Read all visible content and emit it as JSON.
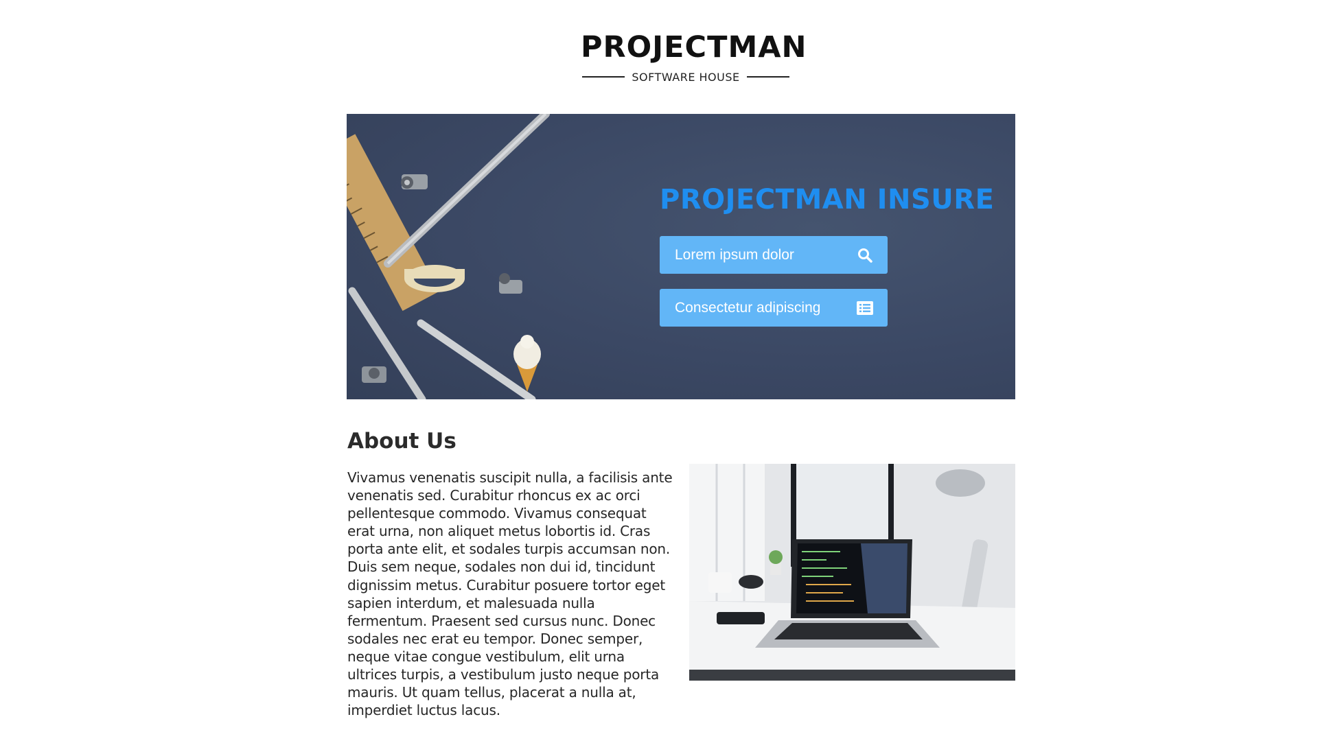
{
  "logo": {
    "title": "PROJECTMAN",
    "subtitle": "SOFTWARE HOUSE"
  },
  "hero": {
    "title": "PROJECTMAN INSURE",
    "buttons": [
      {
        "label": "Lorem ipsum dolor",
        "icon": "search-icon"
      },
      {
        "label": "Consectetur adipiscing",
        "icon": "list-icon"
      }
    ],
    "colors": {
      "background": "#3c4a66",
      "title": "#1f8ef0",
      "button": "#62b6f7"
    }
  },
  "about": {
    "heading": "About Us",
    "body": "Vivamus venenatis suscipit nulla, a facilisis ante venenatis sed. Curabitur rhoncus ex ac orci pellentesque commodo. Vivamus consequat erat urna, non aliquet metus lobortis id. Cras porta ante elit, et sodales turpis accumsan non. Duis sem neque, sodales non dui id, tincidunt dignissim metus. Curabitur posuere tortor eget sapien interdum, et malesuada nulla fermentum. Praesent sed cursus nunc. Donec sodales nec erat eu tempor. Donec semper, neque vitae congue vestibulum, elit urna ultrices turpis, a vestibulum justo neque porta mauris. Ut quam tellus, placerat a nulla at, imperdiet luctus lacus."
  }
}
